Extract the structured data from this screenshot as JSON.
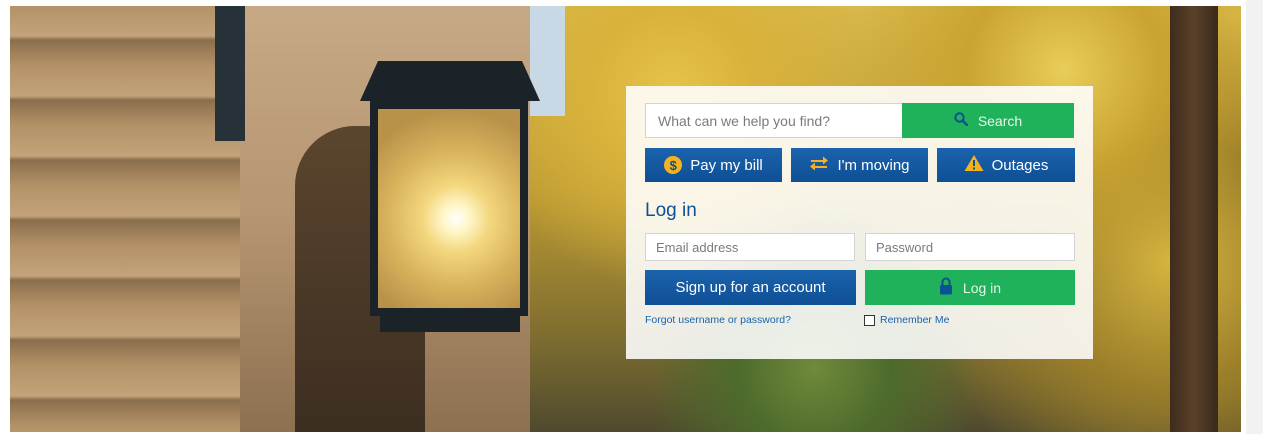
{
  "search": {
    "placeholder": "What can we help you find?",
    "button_label": "Search",
    "icon": "search-icon"
  },
  "quick_actions": [
    {
      "label": "Pay my bill",
      "icon": "dollar-coin-icon",
      "icon_color": "#f4b31c"
    },
    {
      "label": "I'm moving",
      "icon": "swap-arrows-icon",
      "icon_color": "#f4b31c"
    },
    {
      "label": "Outages",
      "icon": "warning-icon",
      "icon_color": "#f4b31c"
    }
  ],
  "login": {
    "title": "Log in",
    "email_placeholder": "Email address",
    "password_placeholder": "Password",
    "signup_label": "Sign up for an account",
    "login_label": "Log in",
    "login_icon": "lock-icon",
    "forgot_label": "Forgot username or password?",
    "remember_label": "Remember Me"
  },
  "colors": {
    "primary_blue": "#0e4f95",
    "green": "#1fb25a",
    "accent_yellow": "#f4b31c"
  }
}
